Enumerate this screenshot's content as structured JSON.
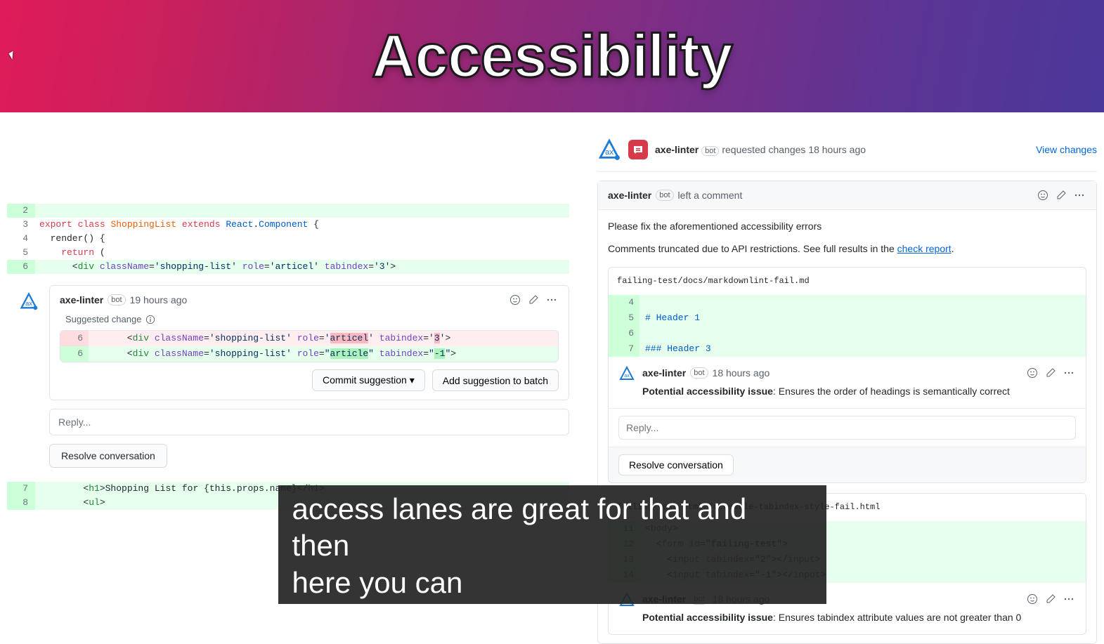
{
  "hero": {
    "title": "Accessibility"
  },
  "left": {
    "code": [
      {
        "ln": "2",
        "add": true,
        "html": ""
      },
      {
        "ln": "3",
        "html": "<span class='k1'>export</span> <span class='k1'>class</span> <span class='k5'>ShoppingList</span> <span class='k1'>extends</span> <span class='k3'>React</span>.<span class='k3'>Component</span> {"
      },
      {
        "ln": "4",
        "html": "  render() {"
      },
      {
        "ln": "5",
        "html": "    <span class='k1'>return</span> ("
      },
      {
        "ln": "6",
        "add": true,
        "html": "      &lt;<span class='k4'>div</span> <span class='k2'>className</span>=<span class='k6'>'shopping-list'</span> <span class='k2'>role</span>=<span class='k6'>'articel'</span> <span class='k2'>tabindex</span>=<span class='k6'>'3'</span>&gt;"
      }
    ],
    "review": {
      "author": "axe-linter",
      "bot": "bot",
      "time": "19 hours ago",
      "suggested_label": "Suggested change",
      "diff": {
        "del": {
          "ln": "6",
          "pre": "      &lt;<span class='k4'>div</span> <span class='k2'>className</span>=<span class='k6'>'shopping-list'</span> <span class='k2'>role</span>=<span class='k6'>'",
          "hl": "articel",
          "mid": "'</span> <span class='k2'>tabindex</span>=<span class='k6'>'",
          "hl2": "3",
          "post": "'</span>&gt;"
        },
        "add": {
          "ln": "6",
          "pre": "      &lt;<span class='k4'>div</span> <span class='k2'>className</span>=<span class='k6'>'shopping-list'</span> <span class='k2'>role</span>=<span class='k6'>\"",
          "hl": "article",
          "mid": "\"</span> <span class='k2'>tabindex</span>=<span class='k6'>\"",
          "hl2": "-1",
          "post": "\"</span>&gt;"
        }
      },
      "commit_btn": "Commit suggestion",
      "batch_btn": "Add suggestion to batch"
    },
    "reply_placeholder": "Reply...",
    "resolve_btn": "Resolve conversation",
    "code_after": [
      {
        "ln": "7",
        "add": true,
        "html": "        &lt;<span class='k4'>h1</span>&gt;Shopping List for {this.props.name}&lt;/<span class='k4'>h1</span>&gt;"
      },
      {
        "ln": "8",
        "add": true,
        "html": "        &lt;<span class='k4'>ul</span>&gt;"
      }
    ]
  },
  "right": {
    "header": {
      "author": "axe-linter",
      "bot": "bot",
      "action": "requested changes",
      "time": "18 hours ago",
      "view_link": "View changes"
    },
    "comment": {
      "author": "axe-linter",
      "bot": "bot",
      "action": "left a comment",
      "body1": "Please fix the aforementioned accessibility errors",
      "body2_pre": "Comments truncated due to API restrictions. See full results in the ",
      "link": "check report",
      "body2_post": "."
    },
    "thread1": {
      "path": "failing-test/docs/markdownlint-fail.md",
      "diff": [
        {
          "ln": "4",
          "html": ""
        },
        {
          "ln": "5",
          "html": "<span class='k3'># Header 1</span>"
        },
        {
          "ln": "6",
          "html": ""
        },
        {
          "ln": "7",
          "html": "<span class='k3'>### Header 3</span>"
        }
      ],
      "author": "axe-linter",
      "bot": "bot",
      "time": "18 hours ago",
      "issue_label": "Potential accessibility issue",
      "issue_text": ": Ensures the order of headings is semantically correct",
      "reply_placeholder": "Reply...",
      "resolve_btn": "Resolve conversation"
    },
    "thread2": {
      "path": "failing-test/html/focusable-tabindex-style-fail.html",
      "diff": [
        {
          "ln": "11",
          "html": "&lt;<span class='k4'>body</span>&gt;"
        },
        {
          "ln": "12",
          "html": "  &lt;<span class='k4'>form</span> <span class='k2'>id</span>=<span class='k6'>\"failing-test\"</span>&gt;"
        },
        {
          "ln": "13",
          "html": "    &lt;<span class='k4'>input</span> <span class='k2'>tabindex</span>=<span class='k6'>\"2\"</span>&gt;&lt;/<span class='k4'>input</span>&gt;"
        },
        {
          "ln": "14",
          "html": "    &lt;<span class='k4'>input</span> <span class='k2'>tabindex</span>=<span class='k6'>\"-1\"</span>&gt;&lt;/<span class='k4'>input</span>&gt;"
        }
      ],
      "author": "axe-linter",
      "bot": "bot",
      "time": "18 hours ago",
      "issue_label": "Potential accessibility issue",
      "issue_text": ": Ensures tabindex attribute values are not greater than 0"
    }
  },
  "caption_line1": "access lanes are great for that and then",
  "caption_line2": "here you can"
}
